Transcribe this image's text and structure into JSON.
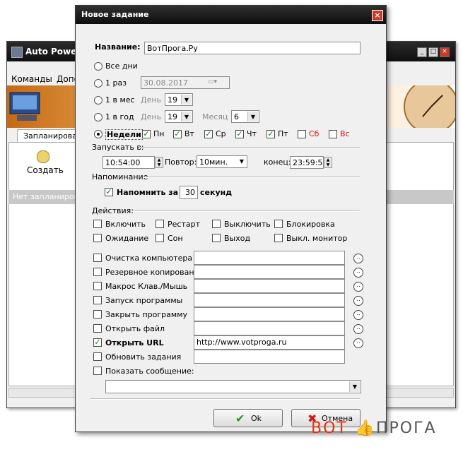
{
  "background_window": {
    "title": "Auto Power-o",
    "menu": [
      "Команды",
      "Допо"
    ],
    "tab": "Запланирован",
    "toolbar_create": "Создать",
    "empty_text": "Нет запланирова"
  },
  "dialog": {
    "title": "Новое задание",
    "name_label": "Название:",
    "name_value": "ВотПрога.Ру",
    "schedule": {
      "every_day": "Все дни",
      "once": "1 раз",
      "once_date": "30.08.2017",
      "monthly": "1 в мес",
      "monthly_day_label": "День",
      "monthly_day_value": "19",
      "yearly": "1 в год",
      "yearly_day_label": "День",
      "yearly_day_value": "19",
      "yearly_month_label": "Месяц",
      "yearly_month_value": "6",
      "weekly": "Недели",
      "selected": "weekly",
      "days": [
        {
          "label": "Пн",
          "checked": true
        },
        {
          "label": "Вт",
          "checked": true
        },
        {
          "label": "Ср",
          "checked": true
        },
        {
          "label": "Чт",
          "checked": true
        },
        {
          "label": "Пт",
          "checked": true
        },
        {
          "label": "Сб",
          "checked": false
        },
        {
          "label": "Вс",
          "checked": false
        }
      ],
      "weekend_color": "#d01010"
    },
    "start": {
      "group_label": "Запускать в:",
      "time": "10:54:00",
      "repeat_label": "Повтор:",
      "repeat_value": "10мин.",
      "end_label": "конец:",
      "end_value": "23:59:59"
    },
    "reminder": {
      "group_label": "Напоминание",
      "text_before": "Напомнить за",
      "seconds": "30",
      "text_after": "секунд",
      "checked": true
    },
    "actions": {
      "group_label": "Действия:",
      "row1": [
        "Включить",
        "Рестарт",
        "Выключить",
        "Блокировка"
      ],
      "row2": [
        "Ожидание",
        "Сон",
        "Выход",
        "Выкл. монитор"
      ],
      "tasks": [
        {
          "label": "Очистка компьютера",
          "checked": false,
          "value": ""
        },
        {
          "label": "Резервное копирование",
          "checked": false,
          "value": ""
        },
        {
          "label": "Макрос Клав./Мышь",
          "checked": false,
          "value": ""
        },
        {
          "label": "Запуск программы",
          "checked": false,
          "value": ""
        },
        {
          "label": "Закрыть программу",
          "checked": false,
          "value": ""
        },
        {
          "label": "Открыть файл",
          "checked": false,
          "value": ""
        },
        {
          "label": "Открыть URL",
          "checked": true,
          "value": "http://www.votproga.ru"
        },
        {
          "label": "Обновить задания",
          "checked": false,
          "value": ""
        }
      ],
      "message_label": "Показать сообщение:",
      "message_value": ""
    },
    "ok_label": "Ok",
    "cancel_label": "Отмена"
  },
  "watermark": {
    "part1": "ВОТ",
    "part2": "ПРОГА",
    "color": "#e63312"
  }
}
